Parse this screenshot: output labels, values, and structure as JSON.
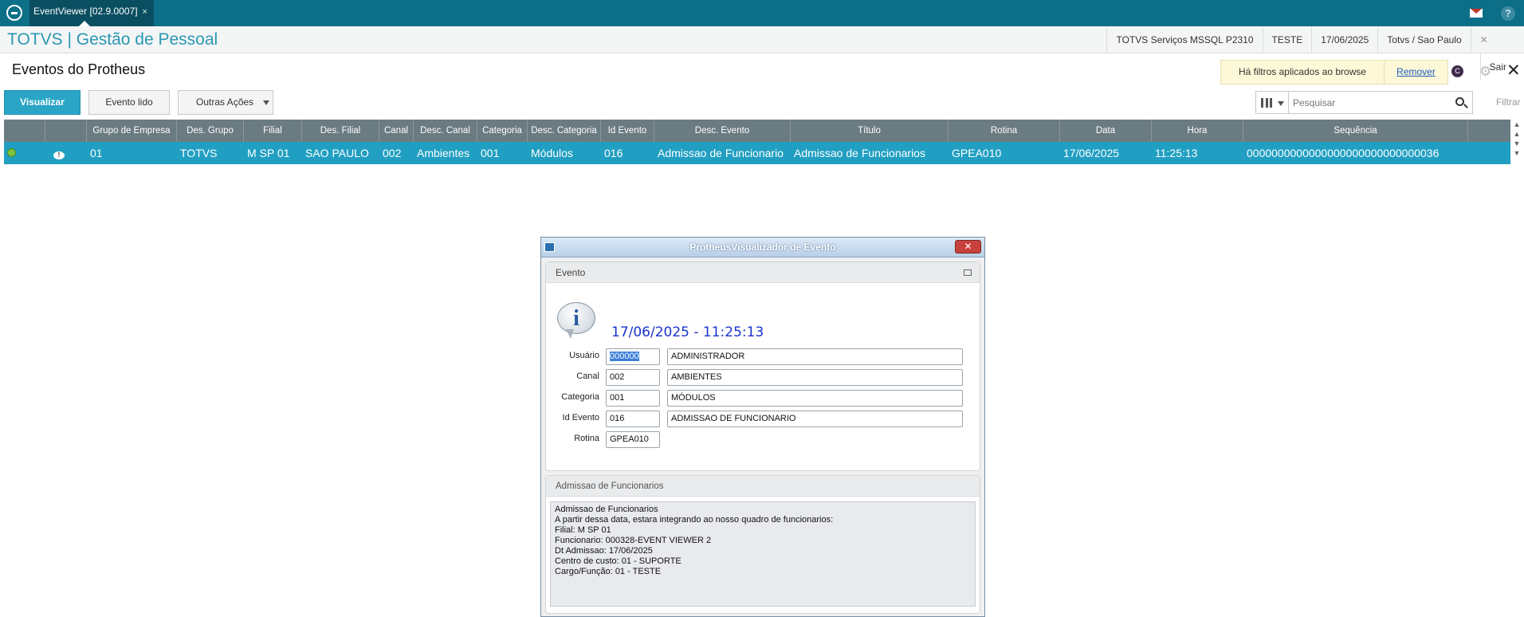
{
  "tab": {
    "label": "EventViewer [02.9.0007]",
    "close": "×"
  },
  "app": {
    "title": "TOTVS | Gestão de Pessoal"
  },
  "env": {
    "server": "TOTVS Serviços MSSQL P2310",
    "environment": "TESTE",
    "date": "17/06/2025",
    "branch": "Totvs / Sao Paulo",
    "logout": "Sair"
  },
  "page": {
    "title": "Eventos do Protheus"
  },
  "filter_notice": {
    "text": "Há filtros aplicados ao browse",
    "remove": "Remover"
  },
  "toolbar": {
    "view": "Visualizar",
    "read_event": "Evento lido",
    "other_actions": "Outras Ações",
    "filter": "Filtrar"
  },
  "search": {
    "placeholder": "Pesquisar"
  },
  "grid": {
    "columns": [
      "",
      "",
      "Grupo de Empresa",
      "Des. Grupo",
      "Filial",
      "Des. Filial",
      "Canal",
      "Desc. Canal",
      "Categoria",
      "Desc. Categoria",
      "Id Evento",
      "Desc. Evento",
      "Título",
      "Rotina",
      "Data",
      "Hora",
      "Sequência"
    ],
    "rows": [
      [
        "",
        "",
        "01",
        "TOTVS",
        "M SP 01",
        "SAO PAULO",
        "002",
        "Ambientes",
        "001",
        "Módulos",
        "016",
        "Admissao de Funcionario",
        "Admissao de Funcionarios",
        "GPEA010",
        "17/06/2025",
        "11:25:13",
        "0000000000000000000000000000036"
      ]
    ]
  },
  "dialog": {
    "title": "ProtheusVisualizador de Evento",
    "section1": "Evento",
    "datetime": "17/06/2025 - 11:25:13",
    "fields": {
      "usuario": {
        "label": "Usuário",
        "code": "000000",
        "desc": "ADMINISTRADOR"
      },
      "canal": {
        "label": "Canal",
        "code": "002",
        "desc": "AMBIENTES"
      },
      "categoria": {
        "label": "Categoria",
        "code": "001",
        "desc": "MÓDULOS"
      },
      "id_evento": {
        "label": "Id Evento",
        "code": "016",
        "desc": "ADMISSAO DE FUNCIONARIO"
      },
      "rotina": {
        "label": "Rotina",
        "code": "GPEA010"
      }
    },
    "section2": "Admissao de Funcionarios",
    "message": [
      "Admissao de Funcionarios",
      "A partir dessa data, estara integrando ao nosso quadro de funcionarios:",
      "Filial: M SP 01",
      "Funcionario: 000328-EVENT VIEWER 2",
      "Dt Admissao: 17/06/2025",
      "Centro de custo: 01 - SUPORTE",
      "Cargo/Função: 01 - TESTE"
    ]
  },
  "colors": {
    "topbar": "#0c6f87",
    "accent": "#2a97b4",
    "selected_row": "#219fc2",
    "grid_header": "#6b7b82"
  }
}
